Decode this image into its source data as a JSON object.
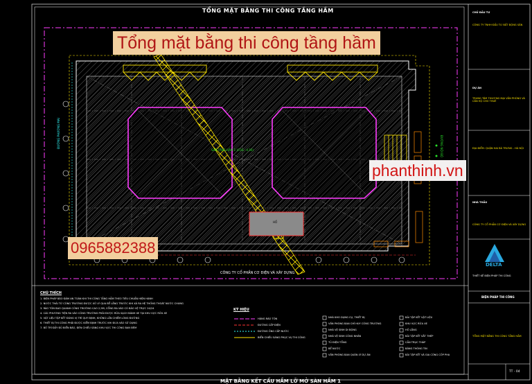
{
  "drawing": {
    "title": "TỔNG MẶT BẰNG THI CÔNG TẦNG HẦM",
    "bottom_title": "MẶT BẰNG KẾT CẤU HẦM LỠ MỞ SÀN HẦM 1",
    "company_label": "CÔNG TY CỔ PHẦN CƠ ĐIỆN VÀ XÂY DỰNG",
    "street_left": "ĐƯỜNG PHƯƠNG MAI",
    "street_right": "ĐƯỜNG NỘI BỘ",
    "center_label": "SÀN TẦNG HẦM 1 (COS: -4.50)",
    "pit_label": "HỐ"
  },
  "overlay": {
    "banner": "Tổng mặt bằng thi công tầng hầm",
    "phone": "0965882388",
    "website": "phanthinh.vn"
  },
  "notes": {
    "heading": "CHÚ THÍCH",
    "lines": [
      "1. BIỆN PHÁP BẢO ĐẢM AN TOÀN KHI THI CÔNG TẦNG HẦM THEO TIÊU CHUẨN HIỆN HÀNH",
      "2. NƯỚC THẢI TỪ CÔNG TRƯỜNG ĐƯỢC XỬ LÝ QUA BỂ LẮNG TRƯỚC KHI XẢ RA HỆ THỐNG THOÁT NƯỚC CHUNG",
      "3. RÀO TÔN BAO QUANH CÔNG TRƯỜNG CAO 2,5M, CỔNG RA VÀO CÓ BẢO VỆ TRỰC 24/24",
      "4. CÁC PHƯƠNG TIỆN RA VÀO CÔNG TRƯỜNG PHẢI ĐƯỢC RỬA SẠCH BÁNH XE TẠI KHU VỰC RỬA XE",
      "5. VẬT LIỆU TẬP KẾT ĐÚNG VỊ TRÍ QUY ĐỊNH, KHÔNG LẤN CHIẾM LÒNG ĐƯỜNG",
      "6. THIẾT BỊ THI CÔNG PHẢI ĐƯỢC KIỂM ĐỊNH TRƯỚC KHI ĐƯA VÀO SỬ DỤNG",
      "7. BỐ TRÍ ĐẦY ĐỦ BIỂN BÁO, ĐÈN CHIẾU SÁNG KHU VỰC THI CÔNG BAN ĐÊM"
    ]
  },
  "legend": {
    "heading": "KÝ HIỆU",
    "lines": [
      {
        "label": "HÀNG RÀO TÔN",
        "color": "#ff3cff"
      },
      {
        "label": "ĐƯỜNG CẤP ĐIỆN",
        "color": "#ff3333"
      },
      {
        "label": "ĐƯỜNG ỐNG CẤP NƯỚC",
        "color": "#33ffff"
      },
      {
        "label": "BIỂN CHIẾU SÁNG PHỤC VỤ THI CÔNG",
        "color": "#ffe600"
      }
    ],
    "col2": [
      "NHÀ KHO DỤNG CỤ, THIẾT BỊ",
      "VĂN PHÒNG BAN CHỈ HUY CÔNG TRƯỜNG",
      "NHÀ VỆ SINH DI ĐỘNG",
      "NHÀ VỆ SINH CÔNG NHÂN",
      "TỦ ĐIỆN TỔNG",
      "BỂ NƯỚC",
      "VĂN PHÒNG BAN QUẢN LÝ DỰ ÁN"
    ],
    "col3": [
      "BÃI TẬP KẾT VẬT LIỆU",
      "KHU VỰC RỬA XE",
      "HỐ LẮNG",
      "BÃI TẬP KẾT SẮT THÉP",
      "CẦN TRỤC THÁP",
      "BẢNG THÔNG TIN",
      "BÃI TẬP KẾT VÀ GIA CÔNG CỐP PHA"
    ]
  },
  "title_block": {
    "owner_h": "CHỦ ĐẦU TƯ",
    "owner": "CÔNG TY TNHH ĐẦU TƯ BẤT ĐỘNG SẢN",
    "project_h": "DỰ ÁN",
    "project": "TRUNG TÂM THƯƠNG MẠI VĂN PHÒNG VÀ CĂN HỘ CHO THUÊ",
    "location": "ĐỊA ĐIỂM: QUẬN HAI BÀ TRƯNG - HÀ NỘI",
    "contractor_h": "NHÀ THẦU",
    "contractor": "CÔNG TY CỔ PHẦN CƠ ĐIỆN VÀ XÂY DỰNG",
    "designer": "THIẾT KẾ BIỆN PHÁP THI CÔNG",
    "company_logo": "DELTA",
    "sheet_title_h": "BIỆN PHÁP THI CÔNG",
    "sheet_name": "TỔNG MẶT BẰNG THI CÔNG TẦNG HẦM",
    "sheet_no": "TT - 04"
  }
}
